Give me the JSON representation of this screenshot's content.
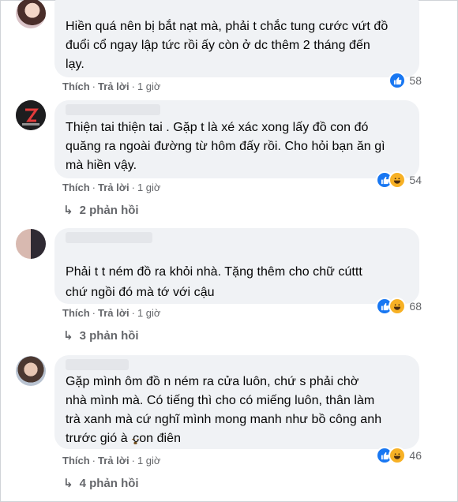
{
  "comments": [
    {
      "avatar": "user-avatar-1",
      "lines": [
        "Hiền quá nên bị bắt nạt mà, phải t chắc tung cước vứt đồ",
        "đuổi cổ ngay lập tức rồi ấy còn ở dc thêm 2 tháng đến",
        "lạy."
      ],
      "like_label": "Thích",
      "reply_label": "Trả lời",
      "time": "1 giờ",
      "reaction_count": "58",
      "reactions": [
        "like-icon"
      ]
    },
    {
      "avatar": "user-avatar-2",
      "lines": [
        "Thiện tai thiện tai . Gặp t là xé xác xong lấy đồ con đó",
        "quăng ra ngoài đường từ hôm đấy rồi. Cho hỏi bạn ăn gì",
        "mà hiền vậy."
      ],
      "like_label": "Thích",
      "reply_label": "Trả lời",
      "time": "1 giờ",
      "reaction_count": "54",
      "reactions": [
        "like-icon",
        "haha-icon"
      ],
      "replies": "2 phản hồi"
    },
    {
      "avatar": "user-avatar-3",
      "line1_before": "Phải t t ném",
      "line1_after": "đồ ra khỏi nhà. Tặng thêm cho chữ cúttt",
      "line2": "chứ ngồi đó mà tớ với cậu",
      "like_label": "Thích",
      "reply_label": "Trả lời",
      "time": "1 giờ",
      "reaction_count": "68",
      "reactions": [
        "like-icon",
        "haha-icon"
      ],
      "replies": "3 phản hồi"
    },
    {
      "avatar": "user-avatar-4",
      "lines": [
        "Gặp mình ôm đồ n ném ra cửa luôn, chứ s phải chờ",
        "nhà mình mà. Có tiếng thì cho có miếng luôn, thân làm",
        "trà xanh mà cứ nghĩ mình mong manh như bồ công anh"
      ],
      "line4_before": "trước gió à",
      "line4_after": "con điên",
      "like_label": "Thích",
      "reply_label": "Trả lời",
      "time": "1 giờ",
      "reaction_count": "46",
      "reactions": [
        "like-icon",
        "haha-icon"
      ],
      "replies": "4 phản hồi"
    }
  ],
  "colors": {
    "bubble": "#f0f2f5",
    "meta": "#65676b",
    "like": "#1877f2",
    "haha": "#f7b125"
  }
}
